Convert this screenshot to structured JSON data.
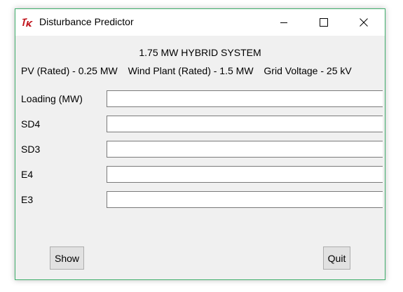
{
  "window": {
    "title": "Disturbance Predictor",
    "app_icon": "tk-feather-icon",
    "controls": {
      "minimize_icon": "minimize-icon",
      "maximize_icon": "maximize-icon",
      "close_icon": "close-icon"
    },
    "border_color": "#3fae6b"
  },
  "main": {
    "heading": "1.75 MW HYBRID SYSTEM",
    "specs": {
      "pv": "PV (Rated) - 0.25 MW",
      "wind": "Wind Plant (Rated) - 1.5 MW",
      "grid": "Grid Voltage - 25 kV"
    },
    "fields": [
      {
        "label": "Loading (MW)",
        "value": ""
      },
      {
        "label": "SD4",
        "value": ""
      },
      {
        "label": "SD3",
        "value": ""
      },
      {
        "label": "E4",
        "value": ""
      },
      {
        "label": "E3",
        "value": ""
      }
    ]
  },
  "buttons": {
    "show_label": "Show",
    "quit_label": "Quit"
  }
}
